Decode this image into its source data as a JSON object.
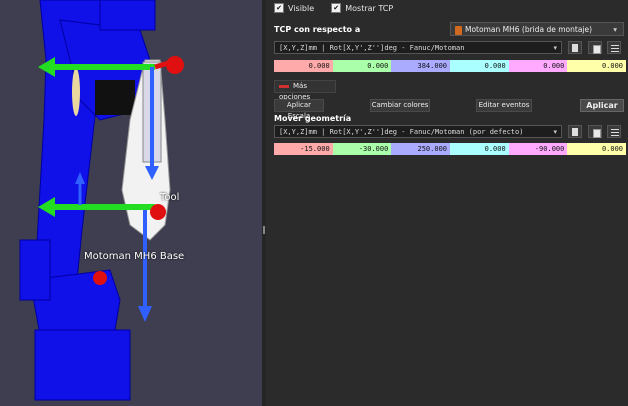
{
  "panel": {
    "visible_label": "Visible",
    "visible_checked": true,
    "show_tcp_label": "Mostrar TCP",
    "show_tcp_checked": true,
    "tcp_relative_label": "TCP con respecto a",
    "reference_combo": "Motoman MH6 (brida de montaje)",
    "tcp_format": "[X,Y,Z]mm | Rot[X,Y',Z'']deg - Fanuc/Motoman",
    "tcp_values": [
      "0.000",
      "0.000",
      "384.000",
      "0.000",
      "0.000",
      "0.000"
    ],
    "more_options_label": "Más opciones",
    "buttons": {
      "apply_scale": "Aplicar Escala",
      "change_colors": "Cambiar colores",
      "edit_events": "Editar eventos",
      "apply": "Aplicar"
    },
    "move_geometry_label": "Mover geometría",
    "geom_format": "[X,Y,Z]mm | Rot[X,Y',Z'']deg - Fanuc/Motoman (por defecto)",
    "geom_values": [
      "-15.000",
      "-30.000",
      "250.000",
      "0.000",
      "-90.000",
      "0.000"
    ],
    "value_colors": [
      "#ffaaaa",
      "#aaffaa",
      "#aaaaff",
      "#aaffff",
      "#ffaaff",
      "#ffffaa"
    ]
  },
  "viewport": {
    "base_label": "Motoman MH6 Base",
    "tool_label": "Tool"
  },
  "icons": [
    "checkbox-icon",
    "robot-icon",
    "paste-icon",
    "copy-icon",
    "menu-icon",
    "dropdown-arrow-icon",
    "red-line-icon"
  ]
}
